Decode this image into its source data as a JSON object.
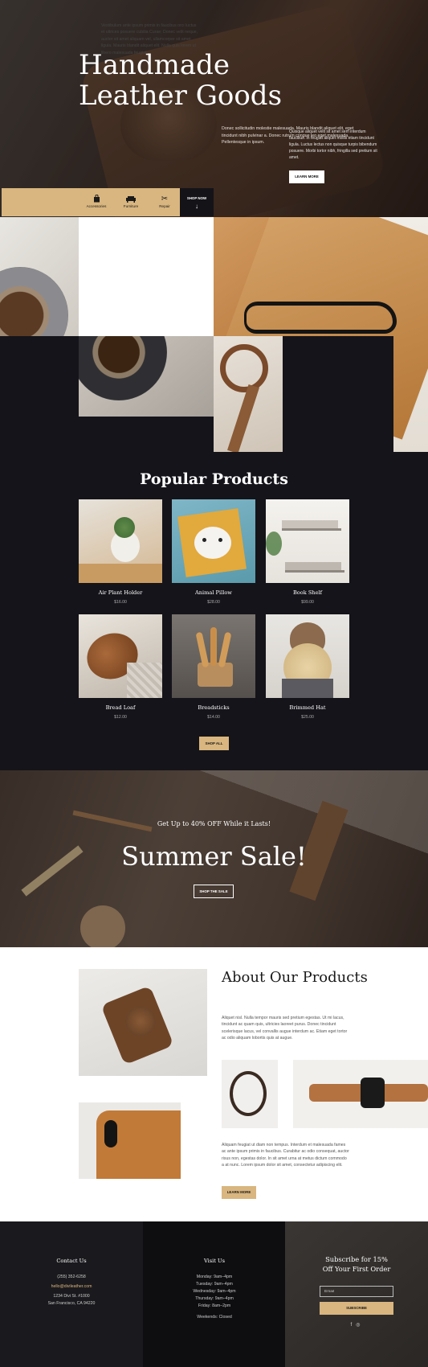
{
  "hero": {
    "title": "Handmade Leather Goods",
    "text": "Donec sollicitudin molestie malesuada. Mauris blandit aliquet elit, eget tincidunt nibh pulvinar a. Donec rutrum congue leo eget malesuada. Pellentesque in ipsum.",
    "categories": [
      {
        "label": "Accessories",
        "icon": "bag-icon"
      },
      {
        "label": "Furniture",
        "icon": "sofa-icon"
      },
      {
        "label": "Repair",
        "icon": "scissors-icon"
      }
    ],
    "shop_now": "SHOP NOW"
  },
  "collage": {
    "white_text": "Vestibulum ante ipsum primis in faucibus orci luctus et ultrices posuere cubilia Curae; Donec velit neque, auctor sit amet aliquam vel, ullamcorper sit amet ligula. Mauris blandit aliquet elit. Nulla quis lorem ut libero malesuada feugiat.",
    "dark_text": "Quisque aliquet velit sit amet sem interdum faucibus. In feugiat aliquet mollis etiam tincidunt ligula. Luctus lectus non quisque turpis bibendum posuere. Morbi tortor nibh, fringilla sed pretium sit amet.",
    "learn_more": "LEARN MORE"
  },
  "popular": {
    "title": "Popular Products",
    "products": [
      {
        "name": "Air Plant Holder",
        "price": "$16.00"
      },
      {
        "name": "Animal Pillow",
        "price": "$28.00"
      },
      {
        "name": "Book Shelf",
        "price": "$99.00"
      },
      {
        "name": "Bread Loaf",
        "price": "$12.00"
      },
      {
        "name": "Breadsticks",
        "price": "$14.00"
      },
      {
        "name": "Brimmed Hat",
        "price": "$25.00"
      }
    ],
    "shop_all": "SHOP ALL"
  },
  "sale": {
    "subtitle": "Get Up to 40% OFF While it Lasts!",
    "title": "Summer Sale!",
    "button": "SHOP THE SALE"
  },
  "about": {
    "title": "About Our Products",
    "p1": "Aliquet nisl. Nulla tempor mauris sed pretium egestas. Ut mi lacus, tincidunt ac quam quis, ultricies laoreet purus. Donec tincidunt scelerisque lacus, vel convallis augue interdum ac. Etiam eget tortor ac odio aliquam lobortis quis at augue.",
    "p2": "Aliquam feugiat ut diam non tempus. Interdum et malesuada fames ac ante ipsum primis in faucibus. Curabitur ac odio consequat, auctor risus non, egestas dolor. In sit amet urna at metus dictum commodo a at nunc. Lorem ipsum dolor sit amet, consectetur adipiscing elit.",
    "learn_more": "LEARN MORE"
  },
  "footer": {
    "contact": {
      "title": "Contact Us",
      "phone": "(255) 352-6258",
      "email": "hello@divileather.com",
      "address1": "1234 Divi St. #1000",
      "address2": "San Francisco, CA 94220"
    },
    "visit": {
      "title": "Visit Us",
      "hours": [
        "Monday: 9am–4pm",
        "Tuesday: 9am–4pm",
        "Wednesday: 9am–4pm",
        "Thursday: 9am–4pm",
        "Friday: 8am–2pm"
      ],
      "weekends": "Weekends: Closed"
    },
    "subscribe": {
      "title": "Subscribe for 15% Off Your First Order",
      "email_placeholder": "Email",
      "button": "SUBSCRIBE",
      "socials": [
        "facebook-icon",
        "instagram-icon"
      ]
    }
  },
  "colors": {
    "accent": "#d9b67f",
    "dark": "#15141a",
    "white": "#ffffff"
  }
}
